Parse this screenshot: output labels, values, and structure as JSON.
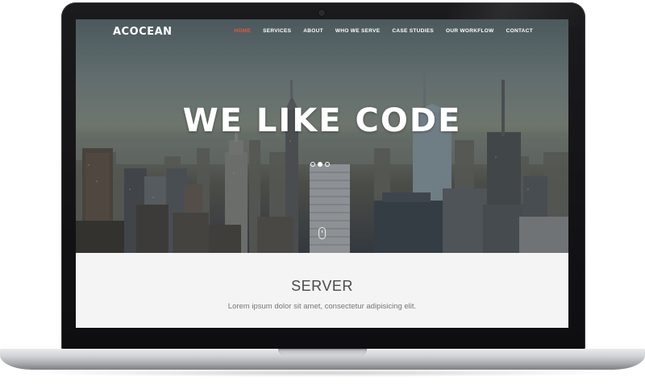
{
  "site": {
    "brand": "ACOCEAN",
    "nav": [
      {
        "label": "HOME",
        "active": true
      },
      {
        "label": "SERVICES",
        "active": false
      },
      {
        "label": "ABOUT",
        "active": false
      },
      {
        "label": "WHO WE SERVE",
        "active": false
      },
      {
        "label": "CASE STUDIES",
        "active": false
      },
      {
        "label": "OUR WORKFLOW",
        "active": false
      },
      {
        "label": "CONTACT",
        "active": false
      }
    ],
    "accent_color": "#e8573c"
  },
  "hero": {
    "title": "WE LIKE CODE",
    "slider": {
      "count": 3,
      "active_index": 2
    }
  },
  "section": {
    "title": "SERVER",
    "text": "Lorem ipsum dolor sit amet, consectetur adipisicing elit."
  }
}
